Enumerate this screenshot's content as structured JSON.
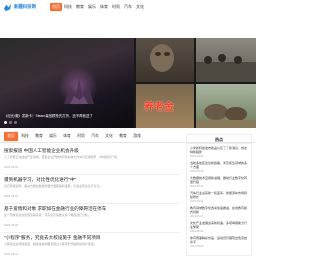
{
  "header": {
    "logo_text": "新疆科技网",
    "nav": [
      "首页",
      "科技",
      "教育",
      "娱乐",
      "体育",
      "时尚",
      "汽车",
      "文化"
    ]
  },
  "hero": {
    "main_caption": "《纪元/魔》发新卡！Steam喜回顾抢先打折，还不再就送了",
    "tile_a_caption": "",
    "tile_b_caption": "",
    "tile_c_text": "养老金",
    "tile_c_caption": "",
    "tile_d_caption": ""
  },
  "categories": [
    "首页",
    "科技",
    "教育",
    "娱乐",
    "体育",
    "时尚",
    "汽车",
    "文化",
    "教育",
    "游戏"
  ],
  "articles": [
    {
      "title": "搜索报道 中国人工智能企业机会升级",
      "summary": "人工智能正在加速产业落地，更多企业开始布局新的技术方向与应用场景，市场前景广阔。",
      "meta": "2023-08-04"
    },
    {
      "title": "遭到机器学习，对比性优化进行\"中\"",
      "summary": "近日有报道称，相关方面在数据处理方面取得新进展，引发业界关注与讨论。",
      "meta": "2023-08-04"
    },
    {
      "title": "基于爱情和对象 求职如在金融行业的障碍活在停车",
      "summary": "这一现象背后的原因值得深思，专家表示需要从多个角度进行分析。",
      "meta": "2023-08-04"
    },
    {
      "title": "\"小程序\"服务，究竟去大校设施于 金融不同项目",
      "summary": "小程序生态持续发展，越来越多的服务通过小程序形式提供给用户使用。",
      "meta": "2023-08-04"
    }
  ],
  "sidebar": {
    "title": "热点",
    "items": [
      {
        "text": "小米新科技发布新品以及了了新消息，的这种新趋势",
        "date": "2023-08-04"
      },
      {
        "text": "当地多地区出台新政策，涉及民生领域的多个方面",
        "date": "2023-08-04"
      },
      {
        "text": "大数据技术应用新进展，推动行业数字化转型升级",
        "date": "2023-08-04"
      },
      {
        "text": "汽车行业迎来新一轮变革，新能源车市场持续增长",
        "date": "2023-08-04"
      },
      {
        "text": "教育领域数字化改革加速推进，在线教育模式创新",
        "date": "2023-08-04"
      },
      {
        "text": "文化产业发展迎来新机遇，多项举措助力行业繁荣",
        "date": "2023-08-04"
      },
      {
        "text": "体育赛事精彩纷呈，运动员们展现出色竞技水平",
        "date": "2023-08-04"
      }
    ]
  }
}
